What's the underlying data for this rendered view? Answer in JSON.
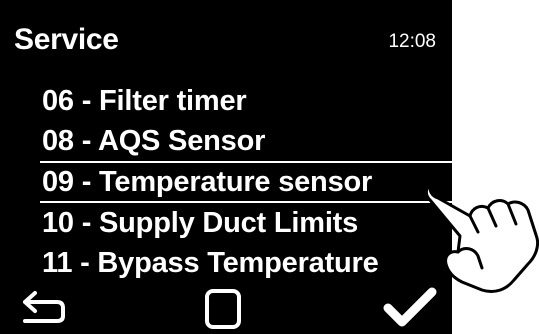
{
  "header": {
    "title": "Service",
    "time": "12:08"
  },
  "menu": {
    "items": [
      {
        "label": "06 - Filter timer",
        "selected": false
      },
      {
        "label": "08 - AQS Sensor",
        "selected": false
      },
      {
        "label": "09 - Temperature sensor",
        "selected": true
      },
      {
        "label": "10 - Supply Duct Limits",
        "selected": false
      },
      {
        "label": "11 - Bypass Temperature",
        "selected": false
      }
    ]
  },
  "footer": {
    "back_icon": "back-arrow-icon",
    "home_icon": "square-icon",
    "confirm_icon": "checkmark-icon"
  },
  "overlay": {
    "pointer_icon": "pointing-hand-icon"
  },
  "colors": {
    "screen_background": "#000000",
    "text": "#ffffff",
    "page_background": "#ffffff"
  }
}
